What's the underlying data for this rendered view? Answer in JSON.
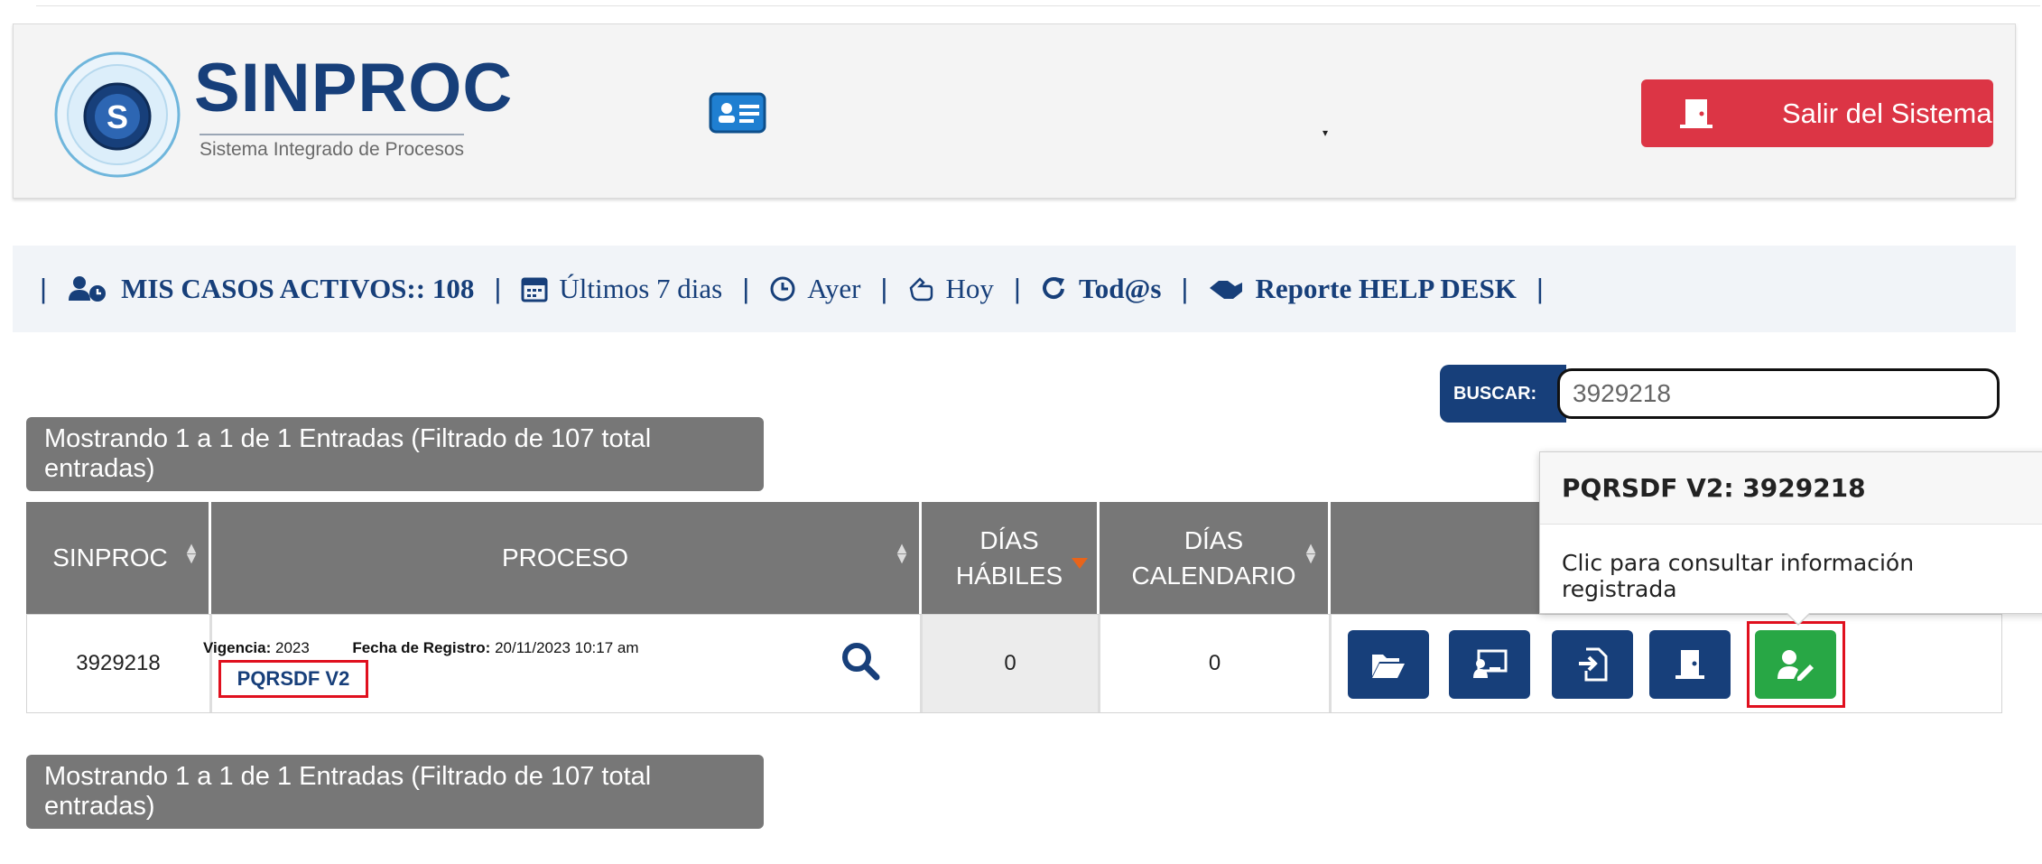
{
  "header": {
    "logo_title": "SINPROC",
    "logo_subtitle": "Sistema Integrado de Procesos",
    "logo_badge": "S",
    "exit_label": "Salir del Sistema",
    "caret": "▾"
  },
  "nav": {
    "items": [
      {
        "label": "MIS CASOS ACTIVOS:: 108",
        "icon": "user-clock-icon"
      },
      {
        "label": "Últimos 7 dias",
        "icon": "calendar-icon"
      },
      {
        "label": "Ayer",
        "icon": "clock-icon"
      },
      {
        "label": "Hoy",
        "icon": "hand-point-left-icon"
      },
      {
        "label": "Tod@s",
        "icon": "redo-icon"
      },
      {
        "label": "Reporte HELP DESK",
        "icon": "handshake-icon"
      }
    ],
    "separator": "|"
  },
  "search": {
    "label": "BUSCAR:",
    "value": "3929218"
  },
  "info_text": "Mostrando 1 a 1 de 1 Entradas (Filtrado de 107 total entradas)",
  "table": {
    "headers": {
      "sinproc": "SINPROC",
      "proceso": "PROCESO",
      "dias_habiles_1": "DÍAS",
      "dias_habiles_2": "HÁBILES",
      "dias_calendario_1": "DÍAS",
      "dias_calendario_2": "CALENDARIO"
    },
    "row": {
      "sinproc": "3929218",
      "vigencia_label": "Vigencia:",
      "vigencia_value": "2023",
      "fecha_label": "Fecha de Registro:",
      "fecha_value": "20/11/2023 10:17 am",
      "codigo": "PQRSDF V2",
      "dias_habiles": "0",
      "dias_calendario": "0"
    }
  },
  "tooltip": {
    "title": "PQRSDF V2: 3929218",
    "body": "Clic para consultar información registrada"
  },
  "colors": {
    "brand": "#173f7a",
    "danger": "#dc3545",
    "success": "#28a745",
    "gray": "#777777",
    "highlight": "#e0101e"
  }
}
